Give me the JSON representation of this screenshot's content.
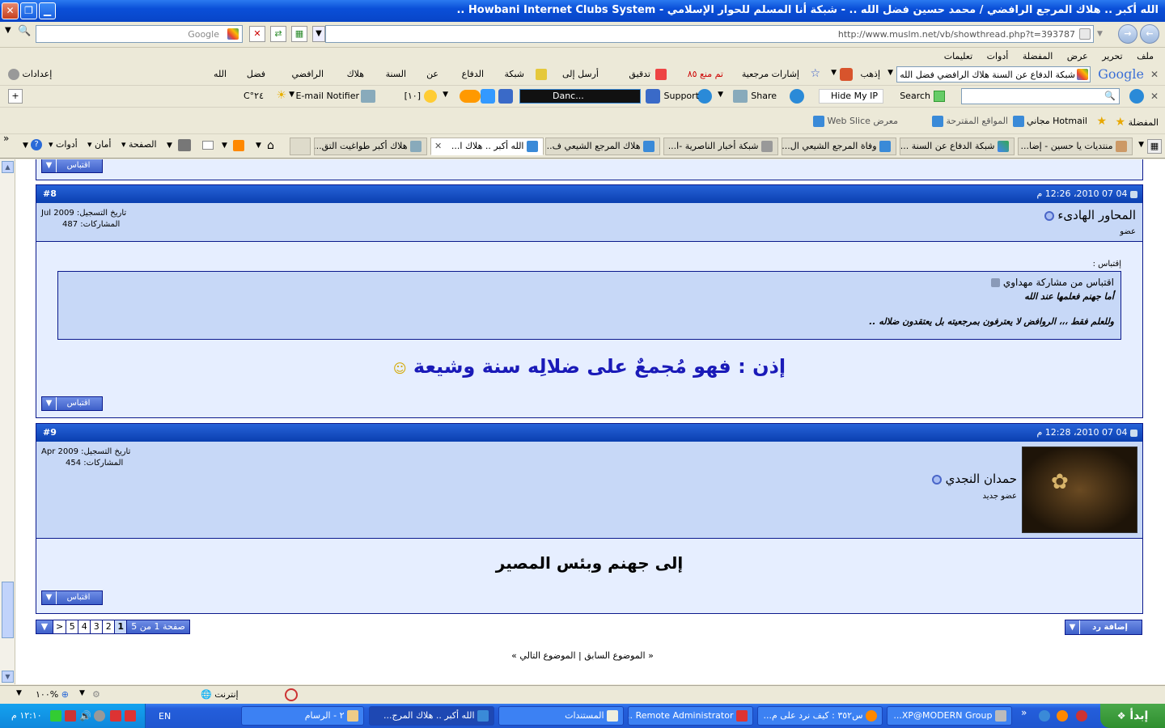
{
  "window": {
    "title": "الله أكبر .. هلاك المرجع الرافضي / محمد حسين فضل الله .. - شبكة أنا المسلم للحوار الإسلامي - Howbani Internet Clubs System .."
  },
  "address": {
    "url": "http://www.muslm.net/vb/showthread.php?t=393787",
    "search_placeholder": "Google"
  },
  "menu": [
    "ملف",
    "تحرير",
    "عرض",
    "المفضلة",
    "أدوات",
    "تعليمات"
  ],
  "google_toolbar": {
    "query": "شبكة الدفاع عن السنة هلاك الرافضي فضل الله",
    "go_label": "إذهب",
    "bookmarks": "إشارات مرجعية",
    "blocked": "تم منع ٨٥",
    "check": "تدقيق",
    "send": "أرسل إلى",
    "words": [
      "شبكة",
      "الدفاع",
      "عن",
      "السنة",
      "هلاك",
      "الرافضي",
      "فضل",
      "الله"
    ],
    "settings": "إعدادات"
  },
  "toolbar2": {
    "search_label": "Search",
    "hide_ip": "Hide My IP",
    "share": "Share",
    "support": "Support",
    "radio": "Danc...",
    "counter": "[١٠]",
    "email": "E-mail Notifier",
    "temp": "٢٤°C"
  },
  "favorites": {
    "label": "المفضلة",
    "items": [
      "Hotmail مجاني",
      "المواقع المقترحة",
      "معرض Web Slice"
    ]
  },
  "tabs": [
    "منتديات يا حسين - إضا...",
    "شبكة الدفاع عن السنة ...",
    "وفاة المرجع الشيعي ال...",
    "شبكة أخبار الناصرية -ا...",
    "هلاك المرجع الشيعي ف...",
    "الله أكبر .. هلاك ا...",
    "هلاك أكبر طواغيت التق..."
  ],
  "ie_commands": [
    "الصفحة",
    "أمان",
    "أدوات"
  ],
  "posts": [
    {
      "number": "#8",
      "date": "04 07 2010، 12:26 م",
      "username": "المحاور الهادىء",
      "usertitle": "عضو",
      "join_label": "تاريخ التسجيل:",
      "join_date": "Jul 2009",
      "posts_label": "المشاركات:",
      "posts_count": "487",
      "quote_label": "إقتباس :",
      "quote_from": "اقتباس من مشاركة مهداوي",
      "quote_line1": "أما جهنم فعلمها عند الله",
      "quote_line2": "وللعلم فقط ،،، الروافض لا يعترفون بمرجعيته بل يعتقدون ضلاله ..",
      "body": "إذن : فهو مُجمعٌ على ضلالِه سنة وشيعة",
      "quote_button": "اقتباس"
    },
    {
      "number": "#9",
      "date": "04 07 2010، 12:28 م",
      "username": "حمدان النجدي",
      "usertitle": "عضو جديد",
      "join_label": "تاريخ التسجيل:",
      "join_date": "Apr 2009",
      "posts_label": "المشاركات:",
      "posts_count": "454",
      "body": "إلى جهنم وبئس المصير",
      "quote_button": "اقتباس"
    }
  ],
  "prev_button": "اقتباس",
  "reply_button": "إضافة رد",
  "pager": {
    "label": "صفحة 1 من 5",
    "pages": [
      "1",
      "2",
      "3",
      "4",
      "5"
    ],
    "next": ">"
  },
  "thread_nav": {
    "prev": "« الموضوع السابق",
    "sep": "|",
    "next": "الموضوع التالي »"
  },
  "statusbar": {
    "zone": "إنترنت",
    "zoom": "١٠٠%"
  },
  "taskbar": {
    "start": "إبدأ",
    "tasks": [
      "XP@MODERN Group...",
      "س٣٥٢ : كيف نرد على م...",
      "Remote Administrator ...",
      "المستندات",
      "الله أكبر .. هلاك المرج...",
      "٢ - الرسام"
    ],
    "lang": "EN",
    "clock": "١٢:١٠ م"
  },
  "colors": {
    "post_header": "#0a3fb0",
    "post_info": "#c7d8f7",
    "post_body": "#e6eeff",
    "body_text": "#1a1ab8"
  }
}
